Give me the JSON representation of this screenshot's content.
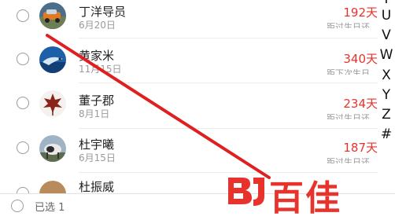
{
  "contacts": [
    {
      "name": "丁洋导员",
      "date": "6月20日",
      "days": "192天",
      "sub": "距过生日还"
    },
    {
      "name": "黄家米",
      "date": "11月15日",
      "days": "340天",
      "sub": "距下次生日"
    },
    {
      "name": "董子郡",
      "date": "8月1日",
      "days": "234天",
      "sub": "距过生日还"
    },
    {
      "name": "杜宇曦",
      "date": "6月15日",
      "days": "187天",
      "sub": "距过生日还"
    },
    {
      "name": "杜振威",
      "date": "",
      "days": "",
      "sub": ""
    }
  ],
  "index_letters": [
    "T",
    "U",
    "V",
    "W",
    "X",
    "Y",
    "Z",
    "#"
  ],
  "footer": {
    "selected_label": "已选 1"
  },
  "brand": {
    "text": "百佳",
    "mark": "BJ"
  },
  "colors": {
    "accent": "#e8332c",
    "text": "#222222",
    "muted": "#9a9a9a"
  }
}
